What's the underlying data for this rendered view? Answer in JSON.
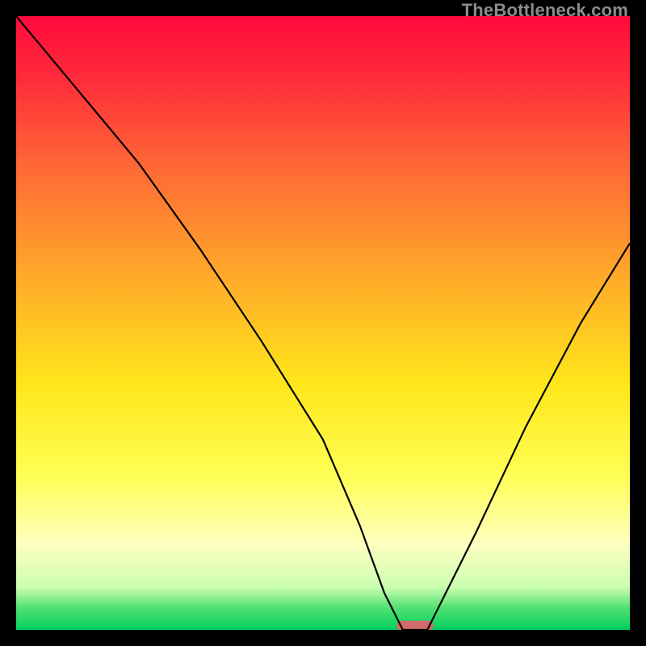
{
  "watermark": {
    "text": "TheBottleneck.com"
  },
  "chart_data": {
    "type": "line",
    "title": "",
    "xlabel": "",
    "ylabel": "",
    "xlim": [
      0,
      100
    ],
    "ylim": [
      0,
      100
    ],
    "grid": false,
    "background": "vertical-gradient red→yellow→pale-green with thin green band at bottom",
    "gradient_stops": [
      {
        "pos": 0.0,
        "color": "#ff0a3d"
      },
      {
        "pos": 0.1,
        "color": "#ff2b3a"
      },
      {
        "pos": 0.25,
        "color": "#ff6a36"
      },
      {
        "pos": 0.45,
        "color": "#ffb327"
      },
      {
        "pos": 0.6,
        "color": "#ffe61a"
      },
      {
        "pos": 0.75,
        "color": "#ffff55"
      },
      {
        "pos": 0.86,
        "color": "#ffffc0"
      },
      {
        "pos": 0.93,
        "color": "#ccffb0"
      },
      {
        "pos": 0.965,
        "color": "#50e070"
      },
      {
        "pos": 1.0,
        "color": "#00d060"
      }
    ],
    "series": [
      {
        "name": "bottleneck-curve",
        "type": "line",
        "stroke": "#000000",
        "x": [
          0,
          10,
          20,
          30,
          40,
          50,
          56,
          60,
          63,
          67,
          75,
          83,
          92,
          100
        ],
        "y": [
          100,
          88,
          76,
          62,
          47,
          31,
          17,
          6,
          0,
          0,
          16,
          33,
          50,
          63
        ]
      }
    ],
    "marker": {
      "name": "optimal-range-marker",
      "x_start": 62,
      "x_end": 68,
      "y": 0.7,
      "shape": "pill",
      "fill": "#d46a6a"
    }
  }
}
